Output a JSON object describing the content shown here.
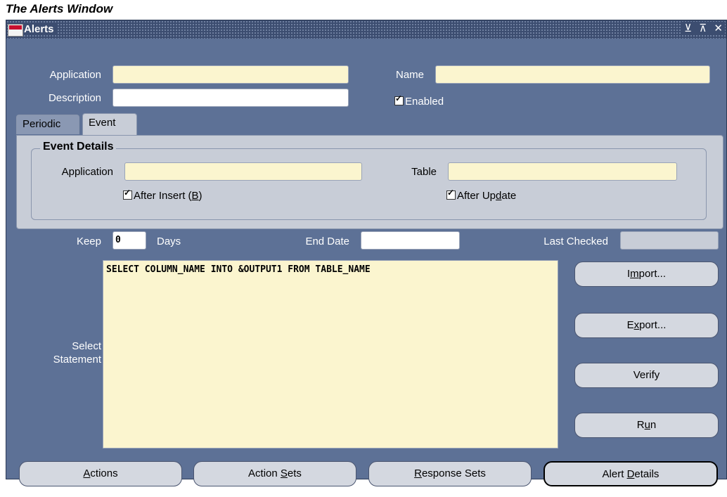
{
  "caption": "The Alerts Window",
  "window": {
    "title": "Alerts",
    "controls": "⊻ ⊼ ✕"
  },
  "form": {
    "application_label": "Application",
    "name_label": "Name",
    "description_label": "Description",
    "enabled_label": "Enabled",
    "enabled_checked": true,
    "application_value": "",
    "name_value": "",
    "description_value": ""
  },
  "tabs": [
    {
      "label": "Periodic",
      "selected": false
    },
    {
      "label": "Event",
      "selected": true
    }
  ],
  "event_details": {
    "title": "Event Details",
    "application_label": "Application",
    "table_label": "Table",
    "after_insert": {
      "pre": "After Insert (",
      "key": "B",
      "post": ")"
    },
    "after_update": {
      "pre": "After Up",
      "key": "d",
      "post": "ate"
    },
    "after_insert_checked": true,
    "after_update_checked": true
  },
  "keep": {
    "label": "Keep",
    "value": "0",
    "units": "Days"
  },
  "end_date_label": "End Date",
  "last_checked_label": "Last Checked",
  "select_statement": {
    "label_line1": "Select",
    "label_line2": "Statement",
    "text": "SELECT COLUMN_NAME INTO &OUTPUT1 FROM TABLE_NAME"
  },
  "side_buttons": {
    "import": {
      "pre": "I",
      "key": "m",
      "post": "port..."
    },
    "export": {
      "pre": "E",
      "key": "x",
      "post": "port..."
    },
    "verify": {
      "pre": "",
      "key": "",
      "post": "Verify"
    },
    "run": {
      "pre": "R",
      "key": "u",
      "post": "n"
    }
  },
  "bottom_buttons": {
    "actions": {
      "pre": "",
      "key": "A",
      "post": "ctions"
    },
    "action_sets": {
      "pre": "Action ",
      "key": "S",
      "post": "ets"
    },
    "response_sets": {
      "pre": "",
      "key": "R",
      "post": "esponse Sets"
    },
    "alert_details": {
      "pre": "Alert ",
      "key": "D",
      "post": "etails"
    }
  },
  "colors": {
    "window_bg": "#5d7196",
    "field_yellow": "#fbf5cf",
    "panel_gray": "#c8cdd7",
    "titlebar": "#3c4d70"
  }
}
